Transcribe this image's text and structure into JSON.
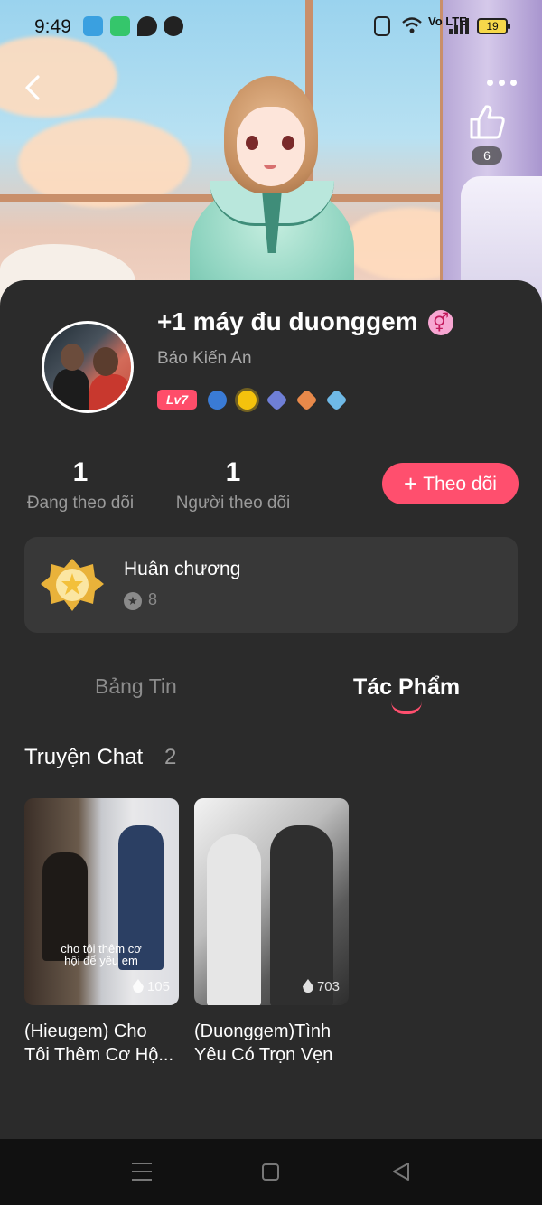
{
  "status_bar": {
    "time": "9:49",
    "network": "Vo LTE",
    "battery": "19"
  },
  "header": {
    "like_count": "6",
    "icons": [
      "back-icon",
      "more-icon",
      "thumbs-up-icon"
    ]
  },
  "profile": {
    "name": "+1 máy đu duonggem",
    "subname": "Báo Kiến An",
    "level_badge": "Lv7",
    "gender_symbol": "⚥",
    "medal_colors": [
      "#3a7bd5",
      "#f4c20d",
      "#6f7fd6",
      "#e8894a",
      "#6fb9e6"
    ]
  },
  "stats": {
    "following_count": "1",
    "following_label": "Đang theo dõi",
    "followers_count": "1",
    "followers_label": "Người theo dõi",
    "follow_button": "Theo dõi"
  },
  "honor": {
    "title": "Huân chương",
    "count": "8"
  },
  "tabs": {
    "news": "Bảng Tin",
    "works": "Tác Phẩm"
  },
  "section": {
    "title": "Truyện Chat",
    "count": "2"
  },
  "stories": [
    {
      "title_line1": "(Hieugem) Cho",
      "title_line2": "Tôi Thêm Cơ Hộ...",
      "views": "105",
      "caption": "cho tôi thêm cơ hội để yêu em"
    },
    {
      "title_line1": "(Duonggem)Tình",
      "title_line2": "Yêu Có Trọn Vẹn",
      "views": "703"
    }
  ],
  "colors": {
    "accent": "#ff4f6e",
    "card_bg": "#2b2b2b",
    "panel_bg": "#383838"
  }
}
